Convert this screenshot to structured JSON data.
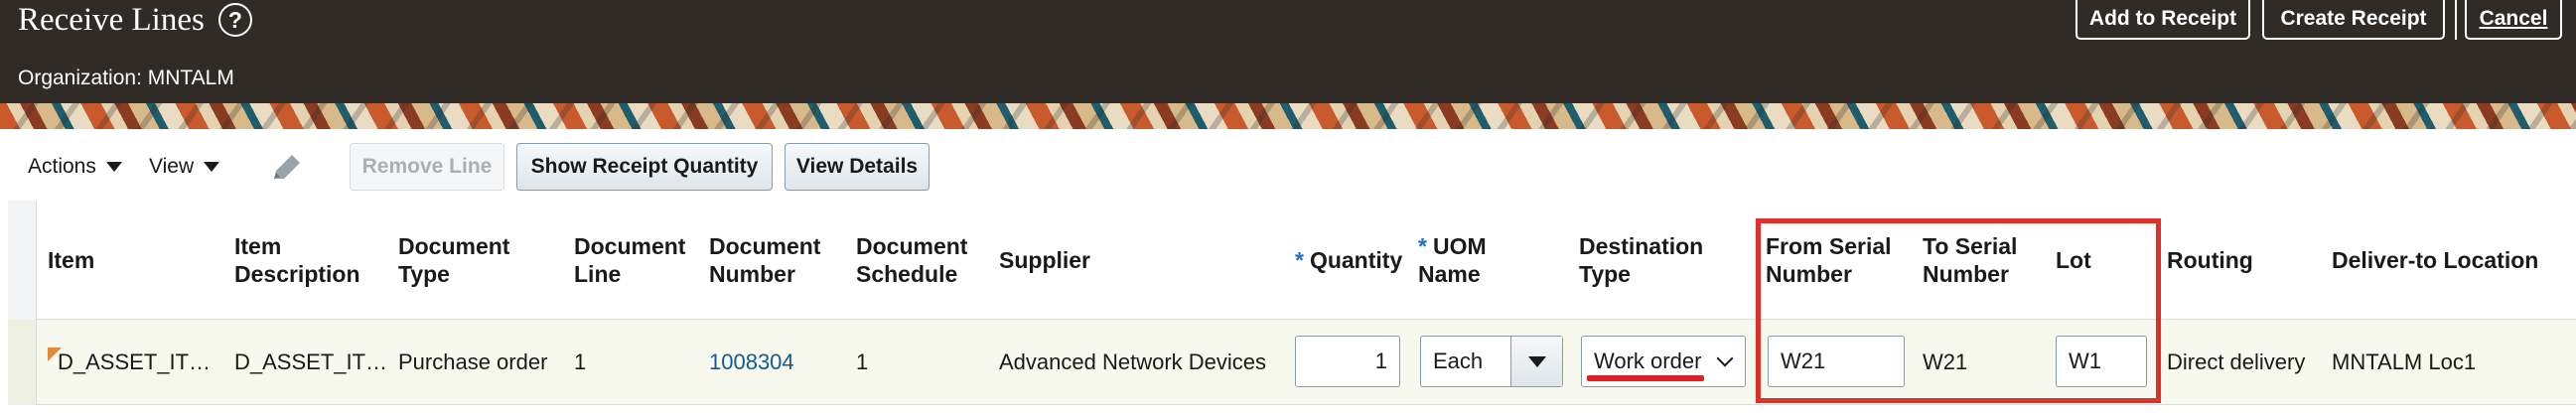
{
  "header": {
    "title": "Receive Lines",
    "help_icon": "question-circle-icon",
    "organization": "Organization: MNTALM",
    "buttons": {
      "add_to_receipt": "Add to Receipt",
      "create_receipt": "Create Receipt",
      "cancel": "Cancel"
    }
  },
  "toolbar": {
    "actions": "Actions",
    "view": "View",
    "edit_icon": "pencil-icon",
    "remove_line": "Remove Line",
    "show_receipt_quantity": "Show Receipt Quantity",
    "view_details": "View Details"
  },
  "table": {
    "columns": {
      "item": "Item",
      "item_description_1": "Item",
      "item_description_2": "Description",
      "document_type_1": "Document",
      "document_type_2": "Type",
      "document_line_1": "Document",
      "document_line_2": "Line",
      "document_number_1": "Document",
      "document_number_2": "Number",
      "document_schedule_1": "Document",
      "document_schedule_2": "Schedule",
      "supplier": "Supplier",
      "required_marker": "*",
      "quantity": "Quantity",
      "uom_name_1": "UOM",
      "uom_name_2": "Name",
      "destination_type_1": "Destination",
      "destination_type_2": "Type",
      "from_serial_1": "From Serial",
      "from_serial_2": "Number",
      "to_serial_1": "To Serial",
      "to_serial_2": "Number",
      "lot": "Lot",
      "routing": "Routing",
      "deliver_to": "Deliver-to Location"
    },
    "row": {
      "item": "D_ASSET_IT…",
      "item_description": "D_ASSET_IT…",
      "document_type": "Purchase order",
      "document_line": "1",
      "document_number": "1008304",
      "document_schedule": "1",
      "supplier": "Advanced Network Devices",
      "quantity": "1",
      "uom_name": "Each",
      "destination_type": "Work order",
      "from_serial_number": "W21",
      "to_serial_number": "W21",
      "lot": "W1",
      "routing": "Direct delivery",
      "deliver_to_location": "MNTALM Loc1"
    }
  },
  "colors": {
    "header_bg": "#302b27",
    "required": "#1a73c9",
    "link": "#135b8f",
    "annotation_red": "#e0302a"
  }
}
